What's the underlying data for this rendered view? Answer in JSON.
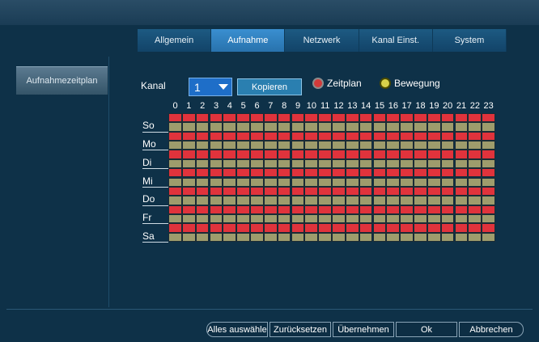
{
  "tabs": [
    {
      "label": "Allgemein",
      "active": false
    },
    {
      "label": "Aufnahme",
      "active": true
    },
    {
      "label": "Netzwerk",
      "active": false
    },
    {
      "label": "Kanal Einst.",
      "active": false
    },
    {
      "label": "System",
      "active": false
    }
  ],
  "sidebar": {
    "label": "Aufnahmezeitplan"
  },
  "channel": {
    "label": "Kanal",
    "value": "1",
    "copy_label": "Kopieren"
  },
  "legend": [
    {
      "label": "Zeitplan",
      "color": "#d23a3a",
      "ring": "#8b8b8b"
    },
    {
      "label": "Bewegung",
      "color": "#d8d24a",
      "ring": "#4a4a00"
    }
  ],
  "hours": [
    "0",
    "1",
    "2",
    "3",
    "4",
    "5",
    "6",
    "7",
    "8",
    "9",
    "10",
    "11",
    "12",
    "13",
    "14",
    "15",
    "16",
    "17",
    "18",
    "19",
    "20",
    "21",
    "22",
    "23"
  ],
  "days": [
    "So",
    "Mo",
    "Di",
    "Mi",
    "Do",
    "Fr",
    "Sa"
  ],
  "schedule": {
    "colors": {
      "zeitplan": "#e0333c",
      "bewegung": "#9e9c6c"
    },
    "rows_per_day": [
      "zeitplan",
      "bewegung"
    ]
  },
  "footer": {
    "select_all": "Alles auswähle",
    "reset": "Zurücksetzen",
    "apply": "Übernehmen",
    "ok": "Ok",
    "cancel": "Abbrechen"
  }
}
